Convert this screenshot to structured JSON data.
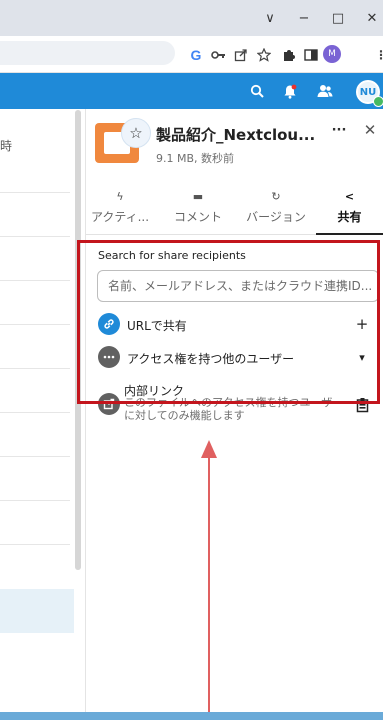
{
  "browser": {
    "window_controls": {
      "dropdown": "∨",
      "minimize": "−",
      "maximize": "□",
      "close": "✕"
    },
    "toolbar": {
      "google_icon_letter": "G",
      "profile_initial": "M",
      "menu_glyph": "⋮"
    }
  },
  "nextcloud_header": {
    "avatar_initials": "NU"
  },
  "file_list": {
    "partial_header_text": "時"
  },
  "sidebar": {
    "file_name": "製品紹介_Nextclou...",
    "file_meta": "9.1 MB, 数秒前",
    "more_glyph": "···",
    "close_glyph": "✕",
    "favorite_glyph": "☆",
    "tabs": [
      {
        "label": "アクティ...",
        "icon": "activity-icon",
        "glyph": "ϟ"
      },
      {
        "label": "コメント",
        "icon": "comment-icon",
        "glyph": "▬"
      },
      {
        "label": "バージョン",
        "icon": "history-icon",
        "glyph": "↻"
      },
      {
        "label": "共有",
        "icon": "share-icon",
        "glyph": "<",
        "active": true
      }
    ]
  },
  "sharing": {
    "search_label": "Search for share recipients",
    "search_placeholder": "名前、メールアドレス、またはクラウド連携ID...",
    "rows": [
      {
        "label": "URLで共有",
        "action_glyph": "+",
        "icon_color": "#1f8ad8"
      },
      {
        "label": "アクセス権を持つ他のユーザー",
        "action_glyph": "▾",
        "icon_color": "#616161"
      },
      {
        "label": "内部リンク",
        "description": "このファイルへのアクセス権を持つユーザーに対してのみ機能します",
        "action_glyph": "⎘",
        "icon_color": "#616161"
      }
    ]
  },
  "annotation": {
    "highlight_color": "#c3151d",
    "arrow_color": "#e06060"
  }
}
